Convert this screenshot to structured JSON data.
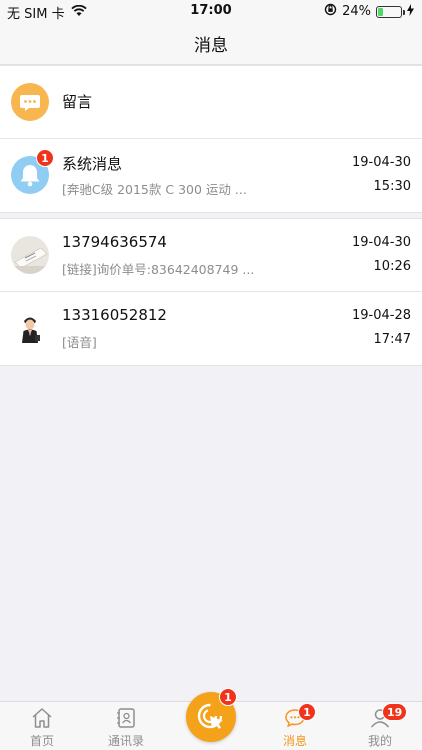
{
  "status_bar": {
    "carrier": "无 SIM 卡",
    "time": "17:00",
    "battery_percent_text": "24%",
    "battery_level": 0.24
  },
  "nav": {
    "title": "消息"
  },
  "top_item": {
    "label": "留言"
  },
  "system_message": {
    "title": "系统消息",
    "subtitle": "[奔驰C级 2015款 C 300 运动 ...",
    "date": "19-04-30",
    "time": "15:30",
    "badge": "1"
  },
  "conversations": [
    {
      "title": "13794636574",
      "subtitle": "[链接]询价单号:83642408749 ...",
      "date": "19-04-30",
      "time": "10:26"
    },
    {
      "title": "13316052812",
      "subtitle": "[语音]",
      "date": "19-04-28",
      "time": "17:47"
    }
  ],
  "tabs": [
    {
      "label": "首页",
      "icon": "home-icon"
    },
    {
      "label": "通讯录",
      "icon": "contacts-icon"
    },
    {
      "label": "消息",
      "icon": "chat-icon",
      "badge": "1",
      "active": true
    },
    {
      "label": "我的",
      "icon": "profile-icon",
      "badge": "19"
    }
  ],
  "center_button": {
    "badge": "1",
    "icon": "cursor-click-icon"
  },
  "colors": {
    "accent": "#f3951c",
    "badge": "#f0331b",
    "bell": "#8fcdf2",
    "message_icon": "#f7b64f"
  }
}
